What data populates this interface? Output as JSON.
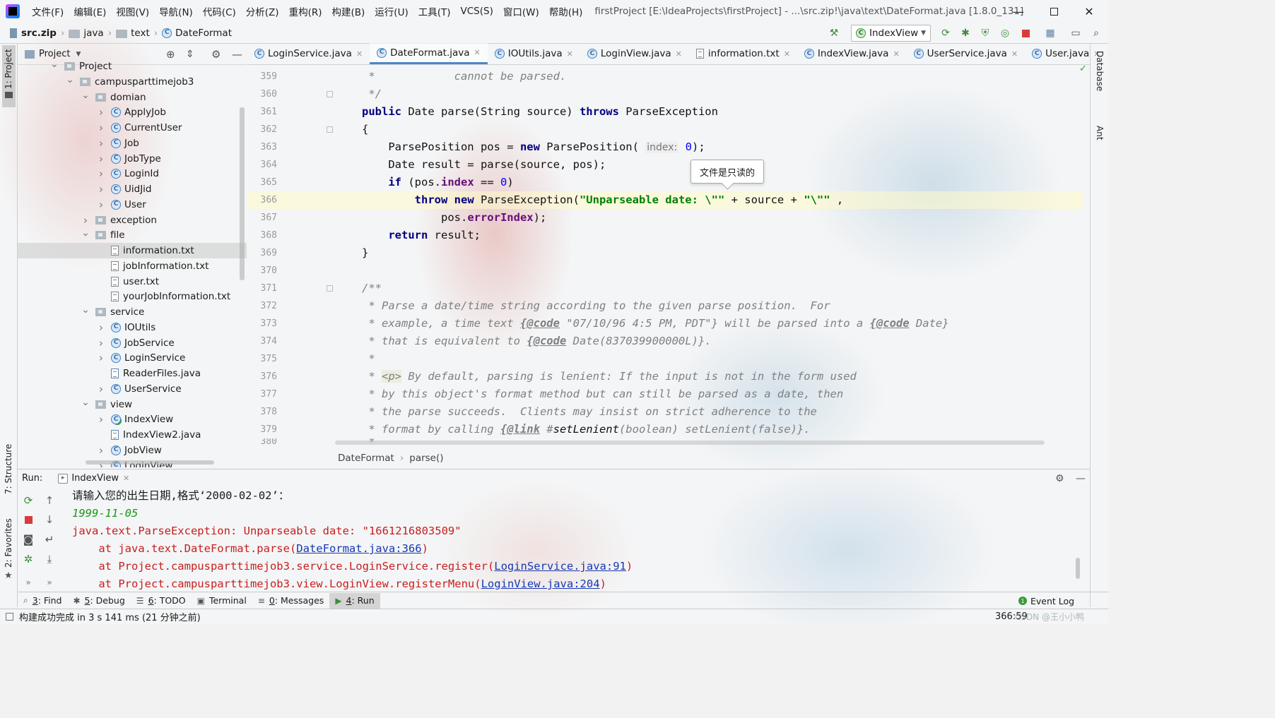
{
  "menu": {
    "items": [
      "文件(F)",
      "编辑(E)",
      "视图(V)",
      "导航(N)",
      "代码(C)",
      "分析(Z)",
      "重构(R)",
      "构建(B)",
      "运行(U)",
      "工具(T)",
      "VCS(S)",
      "窗口(W)",
      "帮助(H)"
    ],
    "title": "firstProject [E:\\IdeaProjects\\firstProject] - ...\\src.zip!\\java\\text\\DateFormat.java [1.8.0_131]"
  },
  "nav": {
    "crumbs": [
      "src.zip",
      "java",
      "text",
      "DateFormat"
    ],
    "run_config": "IndexView"
  },
  "stripes": {
    "left_top": "1: Project",
    "left_structure": "7: Structure",
    "left_favorites": "2: Favorites",
    "right_database": "Database",
    "right_ant": "Ant"
  },
  "project": {
    "title": "Project",
    "tree": [
      {
        "label": "Project",
        "indent": 0,
        "arrow": "down",
        "icon": "folder"
      },
      {
        "label": "campusparttimejob3",
        "indent": 1,
        "arrow": "down",
        "icon": "package"
      },
      {
        "label": "domian",
        "indent": 2,
        "arrow": "down",
        "icon": "package"
      },
      {
        "label": "ApplyJob",
        "indent": 3,
        "arrow": "right",
        "icon": "class"
      },
      {
        "label": "CurrentUser",
        "indent": 3,
        "arrow": "right",
        "icon": "class"
      },
      {
        "label": "Job",
        "indent": 3,
        "arrow": "right",
        "icon": "class"
      },
      {
        "label": "JobType",
        "indent": 3,
        "arrow": "right",
        "icon": "class"
      },
      {
        "label": "LoginId",
        "indent": 3,
        "arrow": "right",
        "icon": "class"
      },
      {
        "label": "UidJid",
        "indent": 3,
        "arrow": "right",
        "icon": "class"
      },
      {
        "label": "User",
        "indent": 3,
        "arrow": "right",
        "icon": "class"
      },
      {
        "label": "exception",
        "indent": 2,
        "arrow": "right",
        "icon": "package"
      },
      {
        "label": "file",
        "indent": 2,
        "arrow": "down",
        "icon": "package"
      },
      {
        "label": "information.txt",
        "indent": 3,
        "arrow": "",
        "icon": "text",
        "selected": true
      },
      {
        "label": "jobInformation.txt",
        "indent": 3,
        "arrow": "",
        "icon": "text"
      },
      {
        "label": "user.txt",
        "indent": 3,
        "arrow": "",
        "icon": "text"
      },
      {
        "label": "yourJobInformation.txt",
        "indent": 3,
        "arrow": "",
        "icon": "text"
      },
      {
        "label": "service",
        "indent": 2,
        "arrow": "down",
        "icon": "package"
      },
      {
        "label": "IOUtils",
        "indent": 3,
        "arrow": "right",
        "icon": "class"
      },
      {
        "label": "JobService",
        "indent": 3,
        "arrow": "right",
        "icon": "class"
      },
      {
        "label": "LoginService",
        "indent": 3,
        "arrow": "right",
        "icon": "class"
      },
      {
        "label": "ReaderFiles.java",
        "indent": 3,
        "arrow": "",
        "icon": "java"
      },
      {
        "label": "UserService",
        "indent": 3,
        "arrow": "right",
        "icon": "class"
      },
      {
        "label": "view",
        "indent": 2,
        "arrow": "down",
        "icon": "package"
      },
      {
        "label": "IndexView",
        "indent": 3,
        "arrow": "right",
        "icon": "class-run"
      },
      {
        "label": "IndexView2.java",
        "indent": 3,
        "arrow": "",
        "icon": "java"
      },
      {
        "label": "JobView",
        "indent": 3,
        "arrow": "right",
        "icon": "class"
      },
      {
        "label": "LoginView",
        "indent": 3,
        "arrow": "right",
        "icon": "class"
      }
    ]
  },
  "tabs": [
    {
      "label": "LoginService.java",
      "icon": "class"
    },
    {
      "label": "DateFormat.java",
      "icon": "class",
      "active": true
    },
    {
      "label": "IOUtils.java",
      "icon": "class"
    },
    {
      "label": "LoginView.java",
      "icon": "class"
    },
    {
      "label": "information.txt",
      "icon": "text"
    },
    {
      "label": "IndexView.java",
      "icon": "class"
    },
    {
      "label": "UserService.java",
      "icon": "class"
    },
    {
      "label": "User.java",
      "icon": "class"
    }
  ],
  "editor": {
    "line_numbers": [
      "359",
      "360",
      "361",
      "362",
      "363",
      "364",
      "365",
      "366",
      "367",
      "368",
      "369",
      "370",
      "371",
      "372",
      "373",
      "374",
      "375",
      "376",
      "377",
      "378",
      "379",
      "380"
    ],
    "highlighted_line": "366",
    "tooltip": "文件是只读的",
    "breadcrumb": [
      "DateFormat",
      "parse()"
    ],
    "code": {
      "l359a": " *            ",
      "l359b": "cannot be parsed.",
      "l360": " */",
      "l361_kw1": "public ",
      "l361_t1": "Date parse(String source) ",
      "l361_kw2": "throws ",
      "l361_t2": "ParseException",
      "l362": "{",
      "l363_t1": "    ParsePosition pos = ",
      "l363_kw": "new ",
      "l363_t2": "ParsePosition( ",
      "l363_hint": "index:",
      "l363_num": " 0",
      "l363_t3": ");",
      "l364": "    Date result = parse(source, pos);",
      "l365_kw": "    if ",
      "l365_t1": "(pos.",
      "l365_fld": "index",
      "l365_t2": " == ",
      "l365_num": "0",
      "l365_t3": ")",
      "l366_kw1": "        throw ",
      "l366_kw2": "new ",
      "l366_t1": "ParseException(",
      "l366_s1": "\"Unparseable date: \\\"\"",
      "l366_t2": " + source + ",
      "l366_s2": "\"\\\"\"",
      "l366_t3": " ,",
      "l367_t1": "            pos.",
      "l367_fld": "errorIndex",
      "l367_t2": ");",
      "l368_kw": "    return ",
      "l368_t": "result;",
      "l369": "}",
      "l371": "/**",
      "l372": " * Parse a date/time string according to the given parse position.  For",
      "l373a": " * example, a time text ",
      "l373tag1": "{@code",
      "l373b": " \"07/10/96 4:5 PM, PDT\"} will be parsed into a ",
      "l373tag2": "{@code",
      "l373c": " Date}",
      "l374a": " * that is equivalent to ",
      "l374tag": "{@code",
      "l374b": " Date(837039900000L)}.",
      "l375": " *",
      "l376a": " * ",
      "l376tag": "<p>",
      "l376b": " By default, parsing is lenient: If the input is not in the form used",
      "l377": " * by this object's format method but can still be parsed as a date, then",
      "l378": " * the parse succeeds.  Clients may insist on strict adherence to the",
      "l379a": " * format by calling ",
      "l379tag": "{@link",
      "l379b": " #",
      "l379m": "setLenient",
      "l379c": "(boolean) setLenient(false)}.",
      "l380": " *"
    }
  },
  "run": {
    "label": "Run:",
    "tab": "IndexView",
    "lines": {
      "prompt": "请输入您的出生日期,格式‘2000-02-02’：",
      "input": "1999-11-05",
      "exception": "java.text.ParseException: Unparseable date: \"1661216803509\"",
      "at1_pre": "    at java.text.DateFormat.parse(",
      "at1_link": "DateFormat.java:366",
      "at1_post": ")",
      "at2_pre": "    at Project.campusparttimejob3.service.LoginService.register(",
      "at2_link": "LoginService.java:91",
      "at2_post": ")",
      "at3_pre": "    at Project.campusparttimejob3.view.LoginView.registerMenu(",
      "at3_link": "LoginView.java:204",
      "at3_post": ")"
    }
  },
  "tooltabs": [
    {
      "mnemonic": "3",
      "rest": ": Find",
      "icon": "search-icon"
    },
    {
      "mnemonic": "5",
      "rest": ": Debug",
      "icon": "bug-icon"
    },
    {
      "mnemonic": "6",
      "rest": ": TODO",
      "icon": "list-icon"
    },
    {
      "mnemonic": "",
      "rest": "Terminal",
      "icon": "terminal-icon"
    },
    {
      "mnemonic": "0",
      "rest": ": Messages",
      "icon": "messages-icon"
    },
    {
      "mnemonic": "4",
      "rest": ": Run",
      "icon": "run-icon",
      "active": true
    }
  ],
  "event_log": "Event Log",
  "status": {
    "message": "构建成功完成 in 3 s 141 ms (21 分钟之前)",
    "position": "366:59",
    "watermark": "CSDN @王小小鸭"
  }
}
